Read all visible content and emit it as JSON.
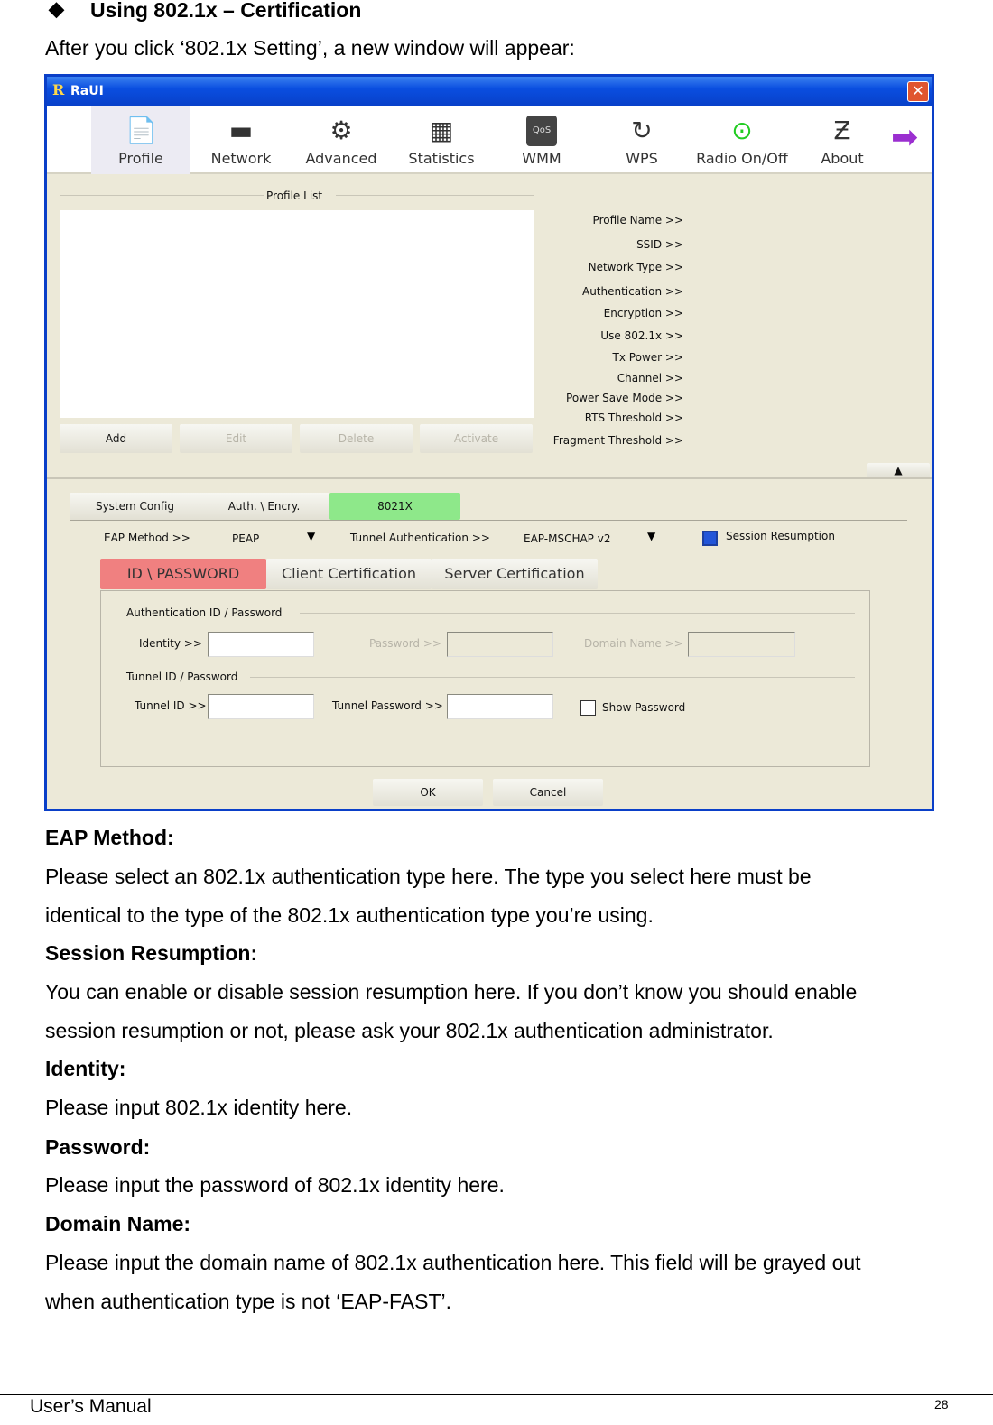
{
  "heading": {
    "bullet": "◆",
    "text": "Using 802.1x – Certification"
  },
  "intro": "After you click ‘802.1x Setting’, a new window will appear:",
  "window": {
    "title": "RaUI",
    "logo": "R",
    "toolbar": [
      {
        "label": "Profile",
        "icon": "profile-icon"
      },
      {
        "label": "Network",
        "icon": "network-icon"
      },
      {
        "label": "Advanced",
        "icon": "gears-icon"
      },
      {
        "label": "Statistics",
        "icon": "calculator-icon"
      },
      {
        "label": "WMM",
        "icon": "qos-icon"
      },
      {
        "label": "WPS",
        "icon": "wps-icon"
      },
      {
        "label": "Radio On/Off",
        "icon": "radio-icon"
      },
      {
        "label": "About",
        "icon": "about-icon"
      }
    ],
    "profile_list_label": "Profile List",
    "profile_buttons": [
      "Add",
      "Edit",
      "Delete",
      "Activate"
    ],
    "profile_fields": [
      "Profile Name >>",
      "SSID >>",
      "Network Type >>",
      "Authentication >>",
      "Encryption >>",
      "Use 802.1x >>",
      "Tx Power >>",
      "Channel >>",
      "Power Save Mode >>",
      "RTS Threshold >>",
      "Fragment Threshold >>"
    ],
    "tabs": [
      "System Config",
      "Auth. \\ Encry.",
      "8021X"
    ],
    "eap_label": "EAP Method >>",
    "eap_value": "PEAP",
    "tunnel_auth_label": "Tunnel Authentication >>",
    "tunnel_auth_value": "EAP-MSCHAP v2",
    "session_resumption": "Session Resumption",
    "session_resumption_checked": true,
    "subtabs": [
      "ID \\ PASSWORD",
      "Client Certification",
      "Server Certification"
    ],
    "auth_group": "Authentication ID / Password",
    "identity_label": "Identity >>",
    "password_label": "Password >>",
    "domain_label": "Domain Name >>",
    "tunnel_group": "Tunnel ID / Password",
    "tunnel_id_label": "Tunnel ID >>",
    "tunnel_password_label": "Tunnel Password >>",
    "show_password": "Show Password",
    "show_password_checked": false,
    "ok": "OK",
    "cancel": "Cancel",
    "colors": {
      "active_tab": "#8ee88a",
      "active_subtab": "#f08080",
      "titlebar": "#0a4ee0"
    }
  },
  "sections": [
    {
      "title": "EAP Method:",
      "lines": [
        "Please select an 802.1x authentication type here. The type you select here must be",
        "identical to the type of the 802.1x authentication type you’re using."
      ]
    },
    {
      "title": "Session Resumption:",
      "lines": [
        "You can enable or disable session resumption here. If you don’t know you should enable",
        "session resumption or not, please ask your 802.1x authentication administrator."
      ]
    },
    {
      "title": "Identity:",
      "lines": [
        "Please input 802.1x identity here."
      ]
    },
    {
      "title": "Password:",
      "lines": [
        "Please input the password of 802.1x identity here."
      ]
    },
    {
      "title": "Domain Name:",
      "lines": [
        "Please input the domain name of 802.1x authentication here. This field will be grayed out",
        "when authentication type is not ‘EAP-FAST’."
      ]
    }
  ],
  "footer": {
    "left": "User’s Manual",
    "page": "28"
  }
}
